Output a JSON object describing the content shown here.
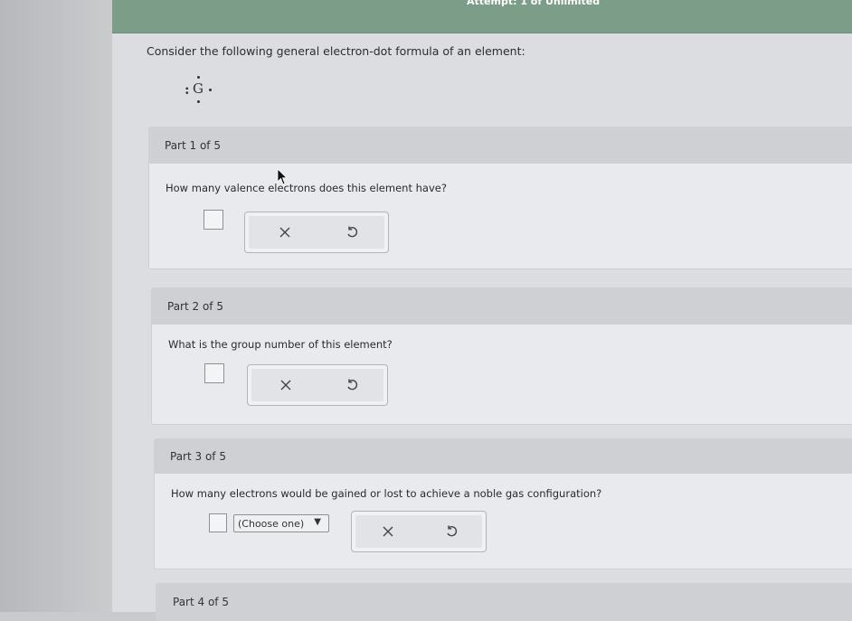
{
  "header": {
    "attempt_text": "Attempt: 1 of Unlimited"
  },
  "question": {
    "prompt": "Consider the following general electron-dot formula of an element:",
    "symbol": "G"
  },
  "parts": [
    {
      "label": "Part 1 of 5",
      "question": "How many valence electrons does this element have?"
    },
    {
      "label": "Part 2 of 5",
      "question": "What is the group number of this element?"
    },
    {
      "label": "Part 3 of 5",
      "question": "How many electrons would be gained or lost to achieve a noble gas configuration?",
      "dropdown_value": "(Choose one)"
    },
    {
      "label": "Part 4 of 5"
    }
  ],
  "tools": {
    "clear_icon": "x-icon",
    "reset_icon": "undo-icon",
    "clear_glyph": "×"
  }
}
